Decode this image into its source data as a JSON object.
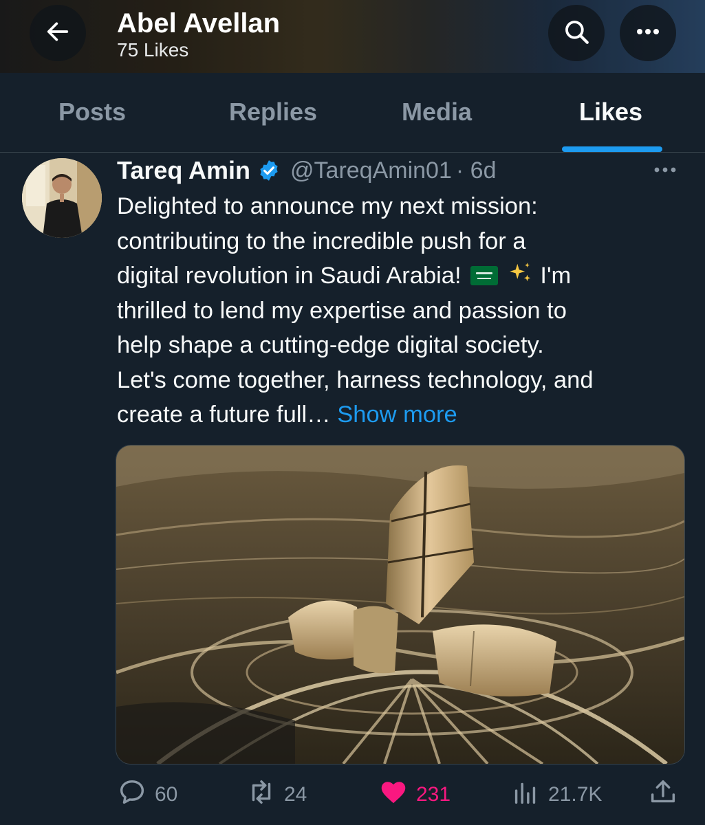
{
  "header": {
    "name": "Abel Avellan",
    "likes_count": "75 Likes",
    "back_icon": "arrow-left-icon",
    "search_icon": "search-icon",
    "more_icon": "more-horizontal-icon"
  },
  "tabs": [
    {
      "label": "Posts",
      "active": false
    },
    {
      "label": "Replies",
      "active": false
    },
    {
      "label": "Media",
      "active": false
    },
    {
      "label": "Likes",
      "active": true
    }
  ],
  "post": {
    "author_name": "Tareq Amin",
    "verified": true,
    "handle": "@TareqAmin01",
    "time": "· 6d",
    "text_lines": [
      "Delighted to announce my next mission:",
      "contributing to the incredible push for a",
      "digital revolution in Saudi Arabia!",
      "I'm",
      "thrilled to lend my expertise and passion to",
      "help shape a cutting-edge digital society.",
      "Let's come together, harness technology, and",
      "create a future full…"
    ],
    "show_more_label": "Show more",
    "image_icon": "aerial-building-photo",
    "stats": {
      "replies": "60",
      "reposts": "24",
      "likes": "231",
      "views": "21.7K"
    }
  },
  "colors": {
    "background": "#15202b",
    "accent": "#1d9bf0",
    "like": "#f91880",
    "muted": "#8b98a5"
  }
}
